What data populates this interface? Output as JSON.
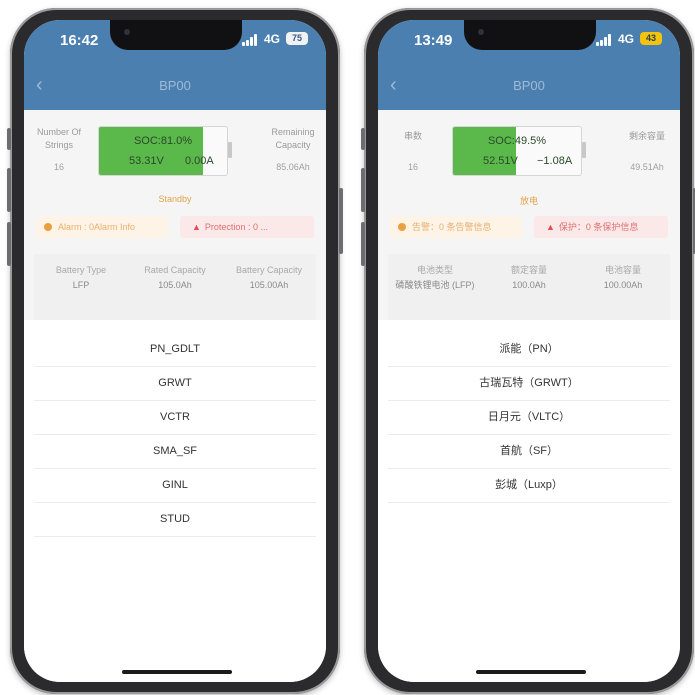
{
  "left_phone": {
    "time": "16:42",
    "network": "4G",
    "battery": "75",
    "nav_title": "BP00",
    "strings_label": "Number Of Strings",
    "strings_value": "16",
    "soc_text": "SOC:81.0%",
    "soc_fraction": 0.81,
    "voltage": "53.31V",
    "current": "0.00A",
    "remaining_label": "Remaining Capacity",
    "remaining_value": "85.06Ah",
    "state": "Standby",
    "alarm_text": "Alarm : 0Alarm Info",
    "protection_text": "Protection : 0 ...",
    "info": [
      {
        "label": "Battery Type",
        "value": "LFP"
      },
      {
        "label": "Rated Capacity",
        "value": "105.0Ah"
      },
      {
        "label": "Battery Capacity",
        "value": "105.00Ah"
      }
    ],
    "options": [
      "PN_GDLT",
      "GRWT",
      "VCTR",
      "SMA_SF",
      "GINL",
      "STUD"
    ]
  },
  "right_phone": {
    "time": "13:49",
    "network": "4G",
    "battery": "43",
    "nav_title": "BP00",
    "strings_label": "串数",
    "strings_value": "16",
    "soc_text": "SOC:49.5%",
    "soc_fraction": 0.495,
    "voltage": "52.51V",
    "current": "−1.08A",
    "remaining_label": "剩余容量",
    "remaining_value": "49.51Ah",
    "state": "放电",
    "alarm_text": "告警：0 条告警信息",
    "protection_text": "保护：0 条保护信息",
    "info": [
      {
        "label": "电池类型",
        "value": "磷酸铁锂电池 (LFP)"
      },
      {
        "label": "额定容量",
        "value": "100.0Ah"
      },
      {
        "label": "电池容量",
        "value": "100.00Ah"
      }
    ],
    "options": [
      "派能（PN）",
      "古瑞瓦特（GRWT）",
      "日月元（VLTC）",
      "首航（SF）",
      "彭城（Luxp）"
    ]
  },
  "colors": {
    "header": "#4a7fb0",
    "soc_green": "#5bb84a",
    "standby_orange": "#e0a44a",
    "alarm_bg": "#fdf3e6",
    "protection_bg": "#fbe8e8"
  }
}
